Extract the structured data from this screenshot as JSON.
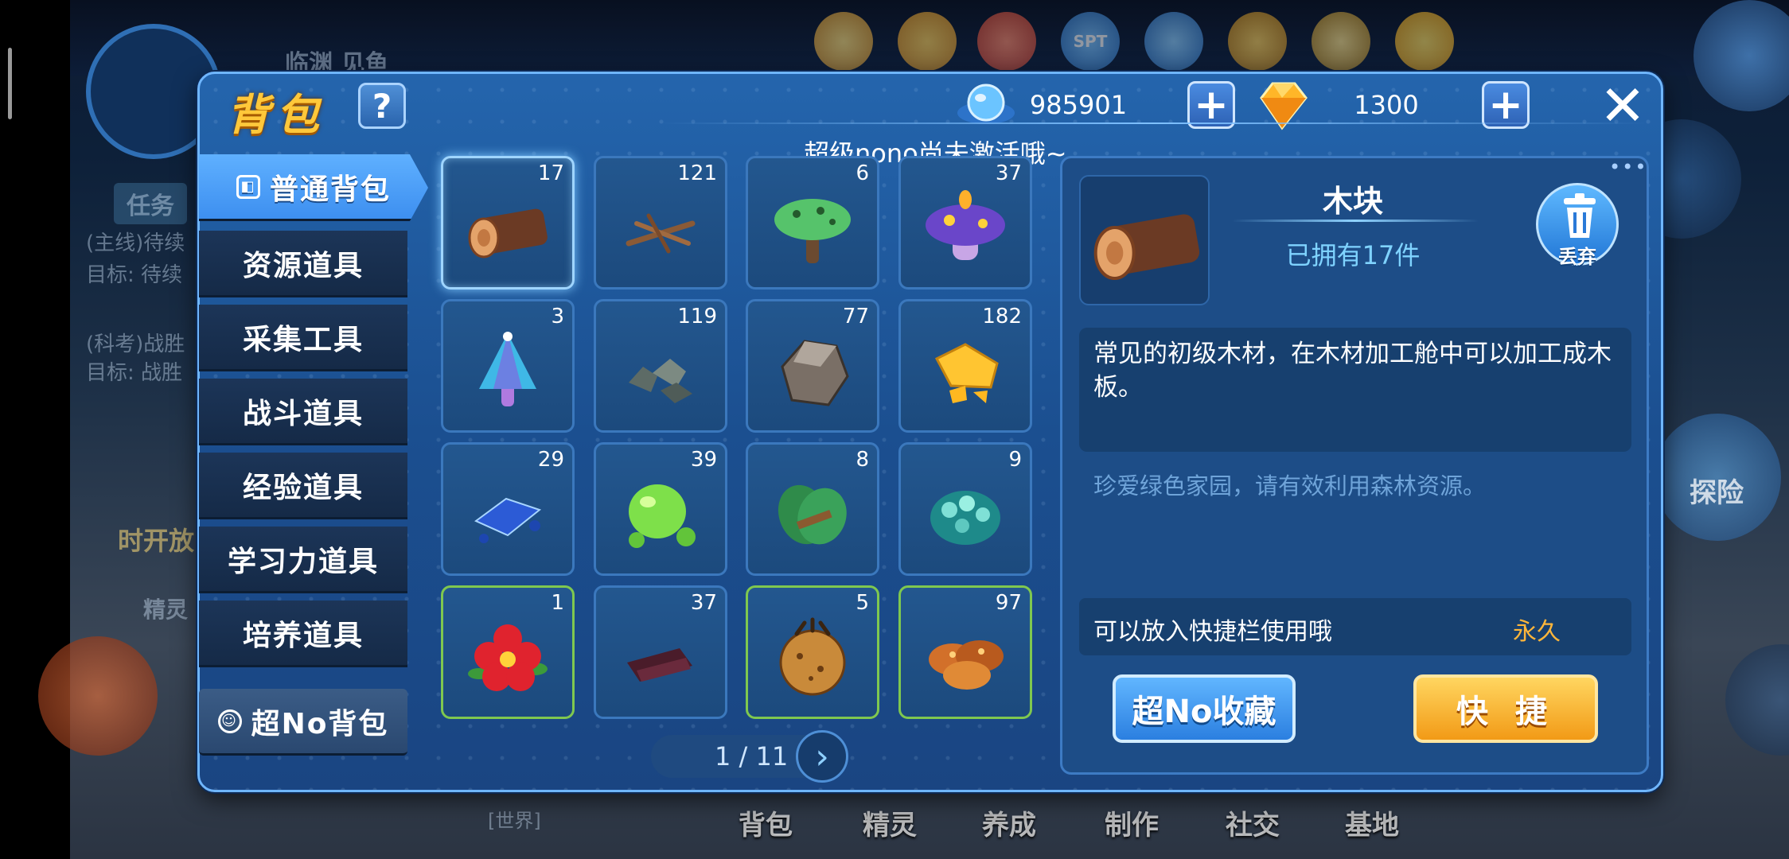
{
  "background": {
    "player_name": "临渊 见鱼",
    "task_tab": "任务",
    "task1_title": "(主线)待续",
    "task1_target": "目标: 待续",
    "task2_title": "(科考)战胜",
    "task2_target": "目标: 战胜",
    "timer_text": "时开放",
    "spirit_text": "精灵",
    "explore_text": "探险",
    "world_chat": "[世界]",
    "spt_label": "SPT",
    "nav": [
      "背包",
      "精灵",
      "养成",
      "制作",
      "社交",
      "基地"
    ]
  },
  "header": {
    "title": "背包",
    "help_label": "?",
    "currency1_value": "985901",
    "currency2_value": "1300",
    "plus_label": "+",
    "close_label": "✕",
    "notice": "超级nono尚未激活哦~"
  },
  "sidebar": {
    "items": [
      {
        "label": "普通背包",
        "active": true,
        "icon": "bag-icon"
      },
      {
        "label": "资源道具"
      },
      {
        "label": "采集工具"
      },
      {
        "label": "战斗道具"
      },
      {
        "label": "经验道具"
      },
      {
        "label": "学习力道具"
      },
      {
        "label": "培养道具"
      },
      {
        "label": "超No背包",
        "icon": "nono-icon"
      }
    ]
  },
  "grid": {
    "items": [
      {
        "icon": "wood-log-icon",
        "count": "17",
        "selected": true
      },
      {
        "icon": "twigs-icon",
        "count": "121"
      },
      {
        "icon": "green-mushroom-icon",
        "count": "6"
      },
      {
        "icon": "purple-mushroom-icon",
        "count": "37"
      },
      {
        "icon": "crystal-mushroom-icon",
        "count": "3"
      },
      {
        "icon": "gray-ore-icon",
        "count": "119"
      },
      {
        "icon": "stone-icon",
        "count": "77"
      },
      {
        "icon": "gold-ore-icon",
        "count": "182"
      },
      {
        "icon": "blue-crystal-icon",
        "count": "29"
      },
      {
        "icon": "green-slime-icon",
        "count": "39"
      },
      {
        "icon": "leaf-bundle-icon",
        "count": "8"
      },
      {
        "icon": "teal-berry-icon",
        "count": "9"
      },
      {
        "icon": "red-flower-icon",
        "count": "1",
        "rare": true
      },
      {
        "icon": "dark-bark-icon",
        "count": "37"
      },
      {
        "icon": "seed-pod-icon",
        "count": "5",
        "rare": true
      },
      {
        "icon": "brown-mushroom-icon",
        "count": "97",
        "rare": true
      }
    ],
    "page": "1 / 11",
    "next_label": "›"
  },
  "detail": {
    "name": "木块",
    "owned": "已拥有17件",
    "discard_label": "丢弃",
    "description": "常见的初级木材，在木材加工舱中可以加工成木板。",
    "flavor": "珍爱绿色家园，请有效利用森林资源。",
    "quickbar_text": "可以放入快捷栏使用哦",
    "duration": "永久",
    "collect_button": "超No收藏",
    "quick_button": "快 捷",
    "more_label": "•••"
  },
  "colors": {
    "title_gold": "#ffc83a",
    "panel_blue": "#2465ad",
    "highlight_cyan": "#7fd3ff",
    "duration_orange": "#ffb63a",
    "rare_border_green": "#7fc84f"
  }
}
